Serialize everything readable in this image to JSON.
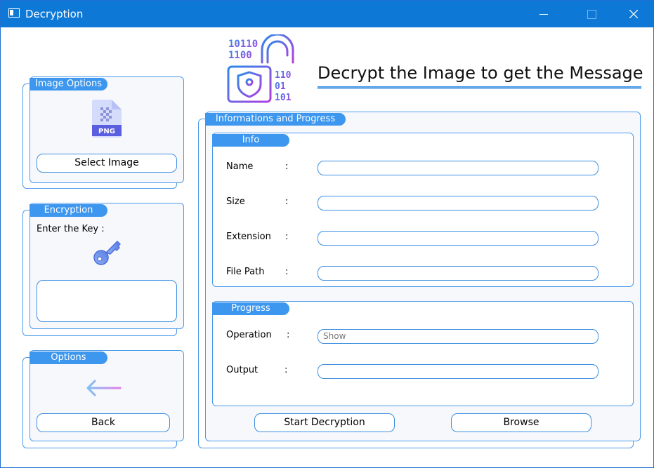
{
  "window": {
    "title": "Decryption"
  },
  "header": {
    "title": "Decrypt the Image to get the Message"
  },
  "image_options": {
    "label": "Image Options",
    "select_label": "Select Image",
    "badge": "PNG"
  },
  "encryption": {
    "label": "Encryption",
    "key_prompt": "Enter the Key :",
    "key_value": ""
  },
  "options": {
    "label": "Options",
    "back_label": "Back"
  },
  "info_progress": {
    "label": "Informations and Progress"
  },
  "info": {
    "label": "Info",
    "fields": [
      {
        "label": "Name",
        "value": ""
      },
      {
        "label": "Size",
        "value": ""
      },
      {
        "label": "Extension",
        "value": ""
      },
      {
        "label": "File Path",
        "value": ""
      }
    ]
  },
  "progress": {
    "label": "Progress",
    "operation_label": "Operation",
    "operation_value": "Show",
    "output_label": "Output",
    "output_value": ""
  },
  "actions": {
    "start_label": "Start Decryption",
    "browse_label": "Browse"
  },
  "colors": {
    "accent": "#3d97ee",
    "border": "#4a9ae8",
    "titlebar": "#0e78d6"
  }
}
